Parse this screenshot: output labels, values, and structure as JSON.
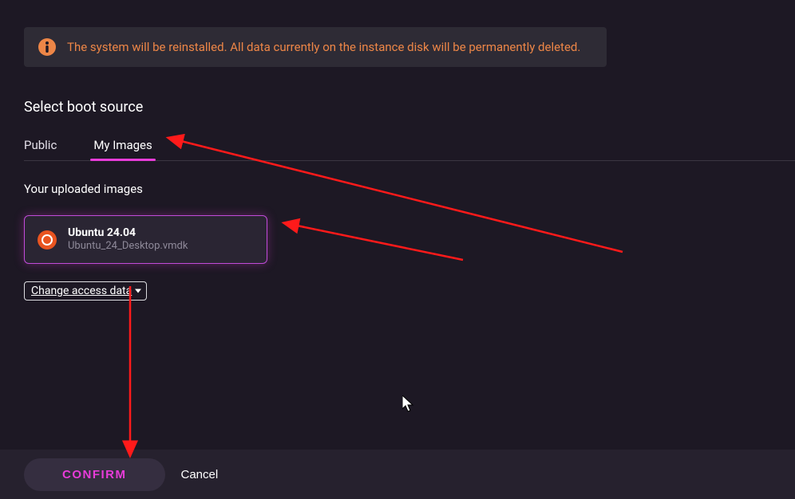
{
  "warning": {
    "text": "The system will be reinstalled. All data currently on the instance disk will be permanently deleted."
  },
  "section_title": "Select boot source",
  "tabs": {
    "public": "Public",
    "my_images": "My Images"
  },
  "sub_title": "Your uploaded images",
  "image": {
    "name": "Ubuntu 24.04",
    "file": "Ubuntu_24_Desktop.vmdk"
  },
  "access_select": {
    "label": "Change access data"
  },
  "footer": {
    "confirm": "CONFIRM",
    "cancel": "Cancel"
  }
}
